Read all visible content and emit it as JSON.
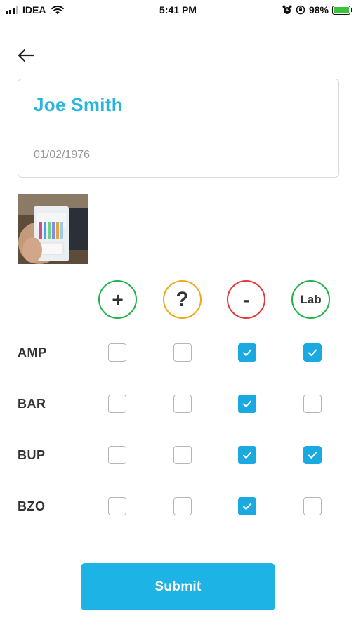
{
  "status_bar": {
    "carrier": "IDEA",
    "time": "5:41 PM",
    "battery_percent": "98%",
    "battery_level": 0.98
  },
  "icons": {
    "back": "arrow-left-icon",
    "signal": "signal-icon",
    "wifi": "wifi-icon",
    "alarm": "alarm-icon",
    "rotation_lock": "rotation-lock-icon",
    "battery": "battery-charging-icon"
  },
  "patient": {
    "name": "Joe Smith",
    "dob": "01/02/1976"
  },
  "results": {
    "columns": [
      {
        "key": "positive",
        "label": "+",
        "color": "#21b24b"
      },
      {
        "key": "unclear",
        "label": "?",
        "color": "#f0a81e"
      },
      {
        "key": "negative",
        "label": "-",
        "color": "#e23a3a"
      },
      {
        "key": "lab",
        "label": "Lab",
        "color": "#21b24b"
      }
    ],
    "rows": [
      {
        "label": "AMP",
        "checked": [
          false,
          false,
          true,
          true
        ]
      },
      {
        "label": "BAR",
        "checked": [
          false,
          false,
          true,
          false
        ]
      },
      {
        "label": "BUP",
        "checked": [
          false,
          false,
          true,
          true
        ]
      },
      {
        "label": "BZO",
        "checked": [
          false,
          false,
          true,
          false
        ]
      }
    ]
  },
  "submit_label": "Submit",
  "colors": {
    "accent": "#1eb3e5",
    "name_text": "#27b5e0",
    "checkbox_checked": "#1ba9e1"
  }
}
